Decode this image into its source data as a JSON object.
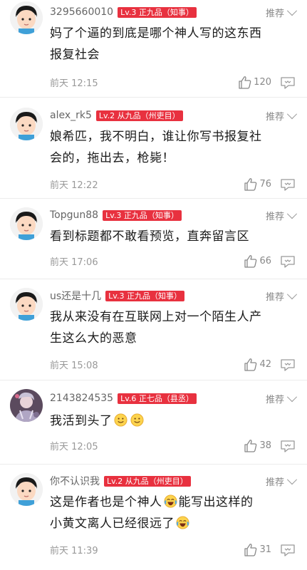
{
  "comments": [
    {
      "username": "3295660010",
      "level": "Lv.3 正九品（知事）",
      "recommend": "推荐",
      "text": [
        "妈了个逼的到底是哪个神人写的这东西",
        "报复社会"
      ],
      "time": "前天 12:15",
      "likes": "120",
      "avatar": "cartoon-boy"
    },
    {
      "username": "alex_rk5",
      "level": "Lv.2 从九品（州吏目）",
      "recommend": "推荐",
      "text": [
        "娘希匹，我不明白，谁让你写书报复社",
        "会的，拖出去，枪毙！"
      ],
      "time": "前天 12:22",
      "likes": "76",
      "avatar": "cartoon-boy"
    },
    {
      "username": "Topgun88",
      "level": "Lv.3 正九品（知事）",
      "recommend": "推荐",
      "text": [
        "看到标题都不敢看预览，直奔留言区"
      ],
      "time": "前天 17:06",
      "likes": "66",
      "avatar": "cartoon-boy"
    },
    {
      "username": "us还是十几",
      "level": "Lv.3 正九品（知事）",
      "recommend": "推荐",
      "text": [
        "我从来没有在互联网上对一个陌生人产",
        "生这么大的恶意"
      ],
      "time": "前天 15:08",
      "likes": "42",
      "avatar": "cartoon-boy"
    },
    {
      "username": "2143824535",
      "level": "Lv.6 正七品（县丞）",
      "recommend": "推荐",
      "text": [
        "我活到头了"
      ],
      "time": "前天 12:05",
      "likes": "38",
      "avatar": "anime-photo"
    },
    {
      "username": "你不认识我",
      "level": "Lv.2 从九品（州吏目）",
      "recommend": "推荐",
      "text": [
        "这是作者也是个神人",
        "能写出这样的",
        "小黄文离人已经很远了"
      ],
      "time": "前天 11:39",
      "likes": "31",
      "avatar": "cartoon-boy"
    }
  ],
  "colors": {
    "level_badge": "#e8313f",
    "meta_text": "#999999"
  },
  "icons": [
    "thumb-up-icon",
    "reply-bubble-icon",
    "chevron-down-icon",
    "smile-emoji",
    "laugh-cry-emoji"
  ]
}
